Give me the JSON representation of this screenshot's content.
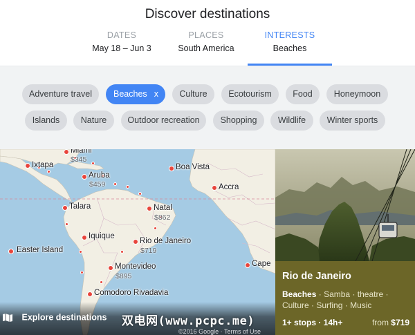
{
  "header": {
    "title": "Discover destinations"
  },
  "tabs": [
    {
      "label": "DATES",
      "value": "May 18 – Jun 3"
    },
    {
      "label": "PLACES",
      "value": "South America"
    },
    {
      "label": "INTERESTS",
      "value": "Beaches"
    }
  ],
  "chips": [
    {
      "label": "Adventure travel"
    },
    {
      "label": "Beaches",
      "remove": "x"
    },
    {
      "label": "Culture"
    },
    {
      "label": "Ecotourism"
    },
    {
      "label": "Food"
    },
    {
      "label": "Honeymoon"
    },
    {
      "label": "Islands"
    },
    {
      "label": "Nature"
    },
    {
      "label": "Outdoor recreation"
    },
    {
      "label": "Shopping"
    },
    {
      "label": "Wildlife"
    },
    {
      "label": "Winter sports"
    }
  ],
  "map": {
    "cities": [
      {
        "name": "Miami",
        "price": "$345"
      },
      {
        "name": "Ixtapa"
      },
      {
        "name": "Aruba",
        "price": "$459"
      },
      {
        "name": "Boa Vista"
      },
      {
        "name": "Accra"
      },
      {
        "name": "Talara"
      },
      {
        "name": "Natal",
        "price": "$862"
      },
      {
        "name": "Iquique"
      },
      {
        "name": "Rio de Janeiro",
        "price": "$719"
      },
      {
        "name": "Easter Island"
      },
      {
        "name": "Montevideo",
        "price": "$895"
      },
      {
        "name": "Cape"
      },
      {
        "name": "Comodoro Rivadavia"
      }
    ],
    "explore_label": "Explore destinations",
    "copyright": "©2016 Google · Terms of Use",
    "icon": "map-icon"
  },
  "card": {
    "city": "Rio de Janeiro",
    "tags": [
      "Beaches",
      "Samba",
      "theatre",
      "Culture",
      "Surfing",
      "Music"
    ],
    "separator": "·",
    "stops": "1+ stops · 14h+",
    "price_prefix": "from",
    "price": "$719"
  },
  "watermark": "双电网(www.pcpc.me)",
  "colors": {
    "accent": "#4285f4",
    "pin": "#e8453c",
    "card_bg": "#6c6628",
    "ocean": "#a5cbe4",
    "land": "#f2efe4"
  }
}
